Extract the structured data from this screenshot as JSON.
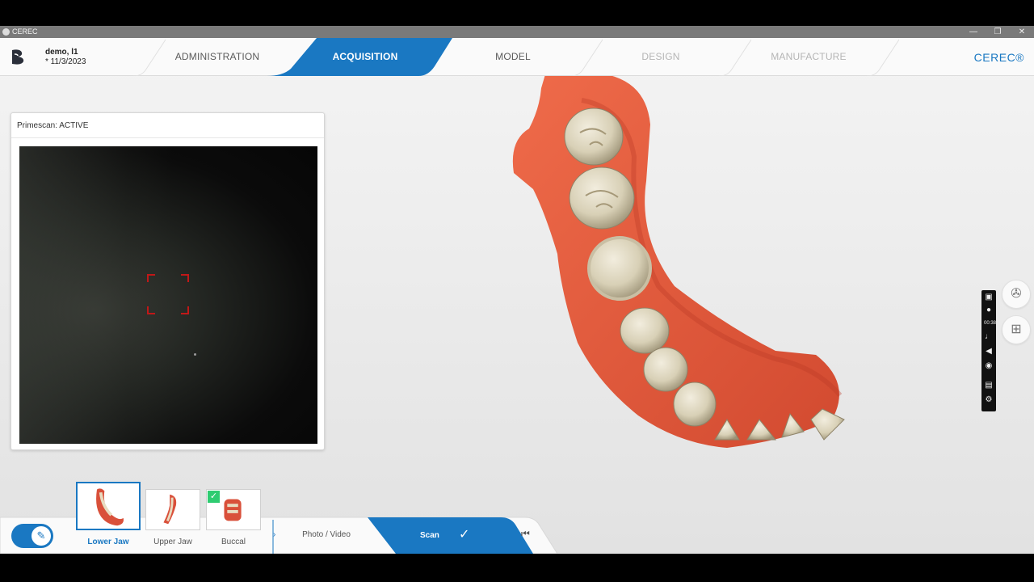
{
  "window": {
    "title": "CEREC",
    "buttons": {
      "minimize": "—",
      "restore": "❐",
      "close": "✕"
    }
  },
  "header": {
    "patient_name": "demo, l1",
    "patient_date": "* 11/3/2023",
    "steps": [
      {
        "label": "ADMINISTRATION",
        "state": "done"
      },
      {
        "label": "ACQUISITION",
        "state": "active"
      },
      {
        "label": "MODEL",
        "state": "available"
      },
      {
        "label": "DESIGN",
        "state": "disabled"
      },
      {
        "label": "MANUFACTURE",
        "state": "disabled"
      }
    ],
    "brand": "CEREC®"
  },
  "camera": {
    "title": "Primescan: ACTIVE"
  },
  "catalog": {
    "items": [
      {
        "label": "Lower Jaw",
        "selected": true,
        "checked": false
      },
      {
        "label": "Upper Jaw",
        "selected": false,
        "checked": false
      },
      {
        "label": "Buccal",
        "selected": false,
        "checked": true
      }
    ]
  },
  "toolbar": {
    "photo_video": "Photo / Video",
    "scan": "Scan"
  },
  "recorder": {
    "timer": "00:38"
  },
  "colors": {
    "accent": "#1a78c2",
    "gingiva": "#e2573a",
    "tooth": "#d9d2bb",
    "check": "#2ecc71"
  },
  "icons": {
    "logo": "cerec-logo-icon",
    "palette": "palette-icon",
    "add-area": "add-area-icon",
    "brush": "brush-icon",
    "check": "check-icon",
    "collapse": "skip-back-icon"
  }
}
